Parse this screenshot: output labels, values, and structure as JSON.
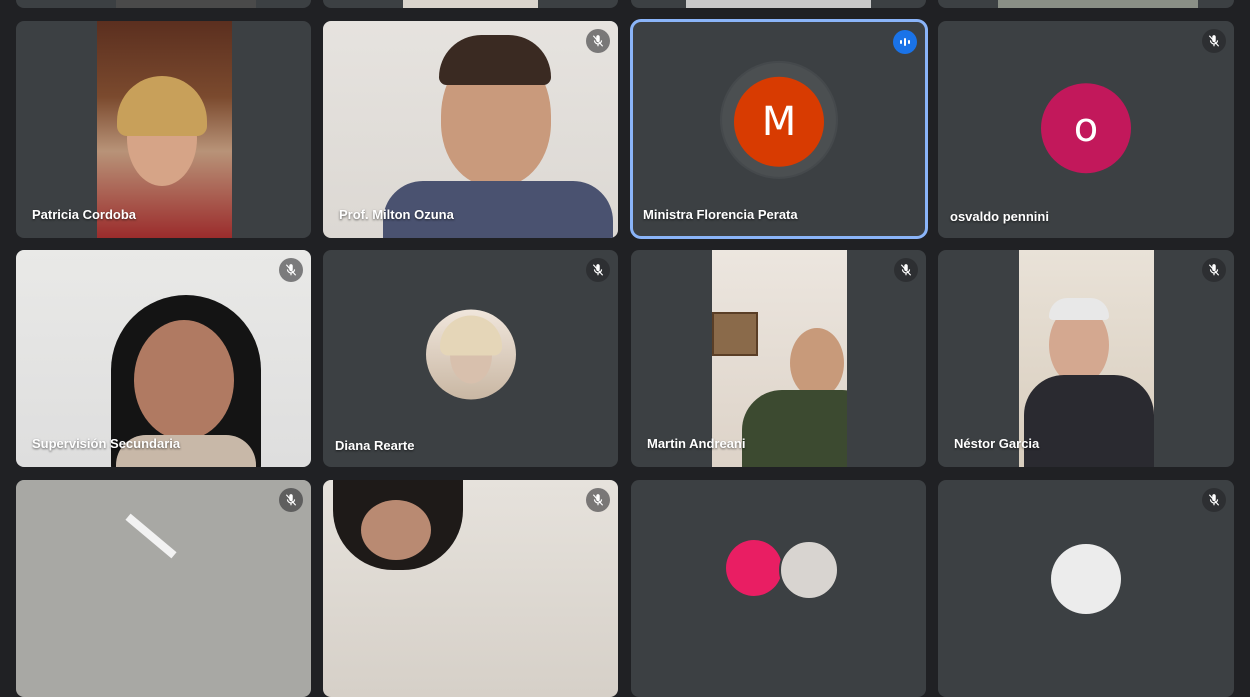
{
  "participants": [
    {
      "name": "Patricia Cordoba",
      "muted": false
    },
    {
      "name": "Prof. Milton Ozuna",
      "muted": true
    },
    {
      "name": "Ministra Florencia Perata",
      "muted": false,
      "speaking": true,
      "avatar_letter": "M",
      "avatar_color": "#d83b01"
    },
    {
      "name": "osvaldo pennini",
      "muted": true,
      "avatar_letter": "o",
      "avatar_color": "#c2185b"
    },
    {
      "name": "Supervisión Secundaria",
      "muted": true
    },
    {
      "name": "Diana Rearte",
      "muted": true
    },
    {
      "name": "Martin Andreani",
      "muted": true
    },
    {
      "name": "Néstor Garcia",
      "muted": true
    }
  ],
  "icons": {
    "mute": "mic-off-icon",
    "speaking": "audio-level-icon"
  },
  "colors": {
    "background": "#202124",
    "tile": "#3c4043",
    "active_speaker_border": "#8ab4f8",
    "speaking_badge": "#1a73e8"
  }
}
